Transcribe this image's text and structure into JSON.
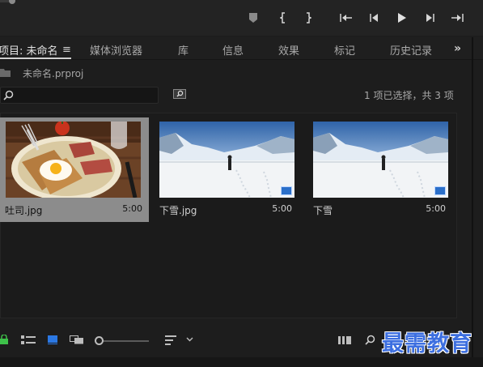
{
  "tabs": [
    {
      "label": "项目: 未命名",
      "active": true
    },
    {
      "label": "媒体浏览器"
    },
    {
      "label": "库"
    },
    {
      "label": "信息"
    },
    {
      "label": "效果"
    },
    {
      "label": "标记"
    },
    {
      "label": "历史记录"
    }
  ],
  "tab_menu_icon": "≡",
  "more_tabs_icon": "»",
  "project": {
    "filename": "未命名.prproj"
  },
  "search": {
    "value": ""
  },
  "selection_status": "1 项已选择，共 3 项",
  "items": [
    {
      "name": "吐司.jpg",
      "duration": "5:00",
      "selected": true,
      "badge": ""
    },
    {
      "name": "下雪.jpg",
      "duration": "5:00",
      "selected": false,
      "badge": "clip-badge-icon"
    },
    {
      "name": "下雪",
      "duration": "5:00",
      "selected": false,
      "badge": "sequence-badge-icon"
    }
  ],
  "watermark": "最需教育",
  "colors": {
    "accent": "#2b6fc9",
    "panel": "#1d1d1d",
    "selected": "#8c8c8c"
  }
}
